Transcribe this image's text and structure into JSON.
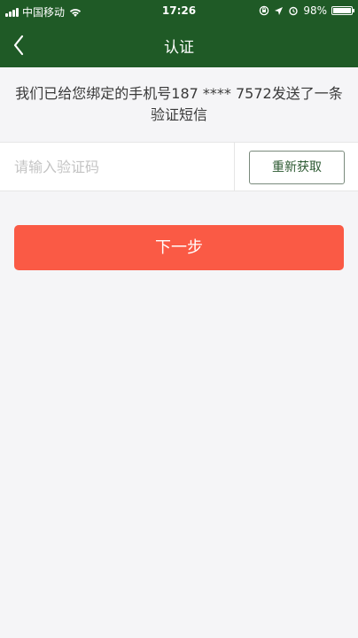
{
  "status_bar": {
    "carrier": "中国移动",
    "time": "17:26",
    "battery_text": "98%",
    "battery_level": 0.98
  },
  "nav": {
    "title": "认证"
  },
  "info": {
    "message": "我们已给您绑定的手机号187 **** 7572发送了一条验证短信"
  },
  "code_input": {
    "placeholder": "请输入验证码",
    "value": ""
  },
  "resend": {
    "label": "重新获取"
  },
  "next": {
    "label": "下一步"
  },
  "colors": {
    "header_bg": "#1f5a26",
    "primary_button": "#fa5a45",
    "resend_text": "#2d5a32",
    "page_bg": "#f5f5f7"
  }
}
